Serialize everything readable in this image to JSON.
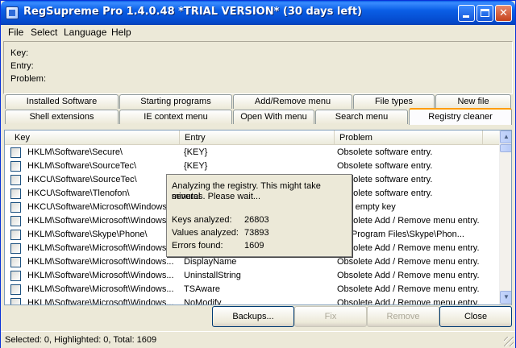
{
  "window": {
    "title": "RegSupreme Pro 1.4.0.48 *TRIAL VERSION* (30 days left)"
  },
  "menu": [
    "File",
    "Select",
    "Language",
    "Help"
  ],
  "info": {
    "key_label": "Key:",
    "entry_label": "Entry:",
    "problem_label": "Problem:"
  },
  "tabs_top": [
    "Installed Software",
    "Starting programs",
    "Add/Remove menu",
    "File types",
    "New file"
  ],
  "tabs_bottom": [
    "Shell extensions",
    "IE context menu",
    "Open With menu",
    "Search menu",
    "Registry cleaner"
  ],
  "active_tab": "Registry cleaner",
  "list": {
    "columns": [
      "Key",
      "Entry",
      "Problem"
    ],
    "rows": [
      {
        "key": "HKLM\\Software\\Secure\\",
        "entry": "{KEY}",
        "problem": "Obsolete software entry."
      },
      {
        "key": "HKLM\\Software\\SourceTec\\",
        "entry": "{KEY}",
        "problem": "Obsolete software entry."
      },
      {
        "key": "HKCU\\Software\\SourceTec\\",
        "entry": "",
        "problem": "Obsolete software entry."
      },
      {
        "key": "HKCU\\Software\\Tlenofon\\",
        "entry": "",
        "problem": "Obsolete software entry."
      },
      {
        "key": "HKCU\\Software\\Microsoft\\Windows",
        "entry": "",
        "problem": "less empty key"
      },
      {
        "key": "HKLM\\Software\\Microsoft\\Windows",
        "entry": "",
        "problem": "Obsolete Add / Remove menu entry."
      },
      {
        "key": "HKLM\\Software\\Skype\\Phone\\",
        "entry": "",
        "problem": "\"C:\\Program Files\\Skype\\Phon..."
      },
      {
        "key": "HKLM\\Software\\Microsoft\\Windows",
        "entry": "",
        "problem": "Obsolete Add / Remove menu entry."
      },
      {
        "key": "HKLM\\Software\\Microsoft\\Windows...",
        "entry": "DisplayName",
        "problem": "Obsolete Add / Remove menu entry."
      },
      {
        "key": "HKLM\\Software\\Microsoft\\Windows...",
        "entry": "UninstallString",
        "problem": "Obsolete Add / Remove menu entry."
      },
      {
        "key": "HKLM\\Software\\Microsoft\\Windows...",
        "entry": "TSAware",
        "problem": "Obsolete Add / Remove menu entry."
      },
      {
        "key": "HKLM\\Software\\Microsoft\\Windows...",
        "entry": "NoModify",
        "problem": "Obsolete Add / Remove menu entry."
      }
    ]
  },
  "popup": {
    "message_line1": "Analyzing the registry. This might take several",
    "message_line2": "minutes. Please wait...",
    "keys_label": "Keys analyzed:",
    "keys_value": "26803",
    "values_label": "Values analyzed:",
    "values_value": "73893",
    "errors_label": "Errors found:",
    "errors_value": "1609"
  },
  "buttons": {
    "backups": "Backups...",
    "fix": "Fix",
    "remove": "Remove",
    "close": "Close"
  },
  "status": "Selected: 0, Highlighted: 0, Total: 1609"
}
